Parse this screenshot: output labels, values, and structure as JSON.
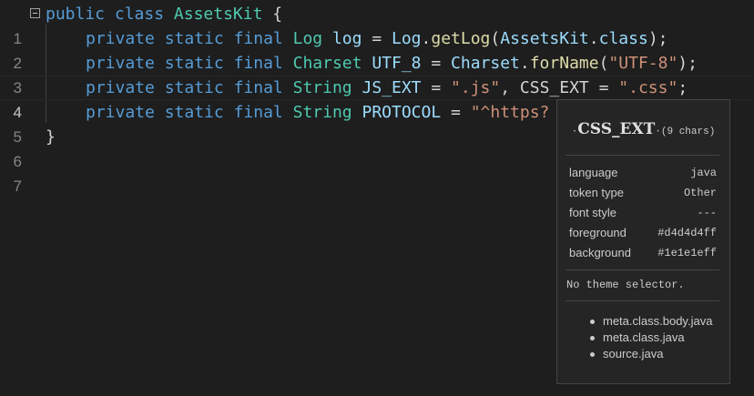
{
  "editor": {
    "line_numbers": [
      "1",
      "2",
      "3",
      "4",
      "5",
      "6",
      "7"
    ],
    "active_line": 4,
    "lines": {
      "l1": {
        "kw1": "public",
        "kw2": "class",
        "type": "AssetsKit",
        "brace": " {"
      },
      "l2": {
        "kw1": "private",
        "kw2": "static",
        "kw3": "final",
        "type": "Log",
        "var": "log",
        "eq": " = ",
        "cls": "Log",
        "dot": ".",
        "fn": "getLog",
        "open": "(",
        "arg": "AssetsKit",
        "dot2": ".",
        "arg2": "class",
        "close": ");"
      },
      "l3": {
        "kw1": "private",
        "kw2": "static",
        "kw3": "final",
        "type": "Charset",
        "var": "UTF_8",
        "eq": " = ",
        "cls": "Charset",
        "dot": ".",
        "fn": "forName",
        "open": "(",
        "str": "\"UTF-8\"",
        "close": ");"
      },
      "l4": {
        "kw1": "private",
        "kw2": "static",
        "kw3": "final",
        "type": "String",
        "var": "JS_EXT",
        "eq": " = ",
        "str": "\".js\"",
        "comma": ", ",
        "var2": "CSS_EXT",
        "eq2": " = ",
        "str2": "\".css\"",
        "semi": ";"
      },
      "l5": {
        "kw1": "private",
        "kw2": "static",
        "kw3": "final",
        "type": "String",
        "var": "PROTOCOL",
        "eq": " = ",
        "str": "\"^https?"
      },
      "l6": {
        "brace": "}"
      }
    }
  },
  "hover": {
    "dot_left": "·",
    "token": "CSS_EXT",
    "dot_right": "·",
    "char_count": "(9 chars)",
    "rows": [
      {
        "key": "language",
        "value": "java"
      },
      {
        "key": "token type",
        "value": "Other"
      },
      {
        "key": "font style",
        "value": "---"
      },
      {
        "key": "foreground",
        "value": "#d4d4d4ff"
      },
      {
        "key": "background",
        "value": "#1e1e1eff"
      }
    ],
    "note": "No theme selector.",
    "scopes": [
      "meta.class.body.java",
      "meta.class.java",
      "source.java"
    ]
  },
  "colors": {
    "background": "#1e1e1e",
    "keyword": "#569cd6",
    "type": "#4ec9b0",
    "function": "#dcdcaa",
    "variable": "#9cdcfe",
    "string": "#ce9178",
    "text": "#d4d4d4",
    "hover_background": "#252526",
    "hover_border": "#454545"
  }
}
